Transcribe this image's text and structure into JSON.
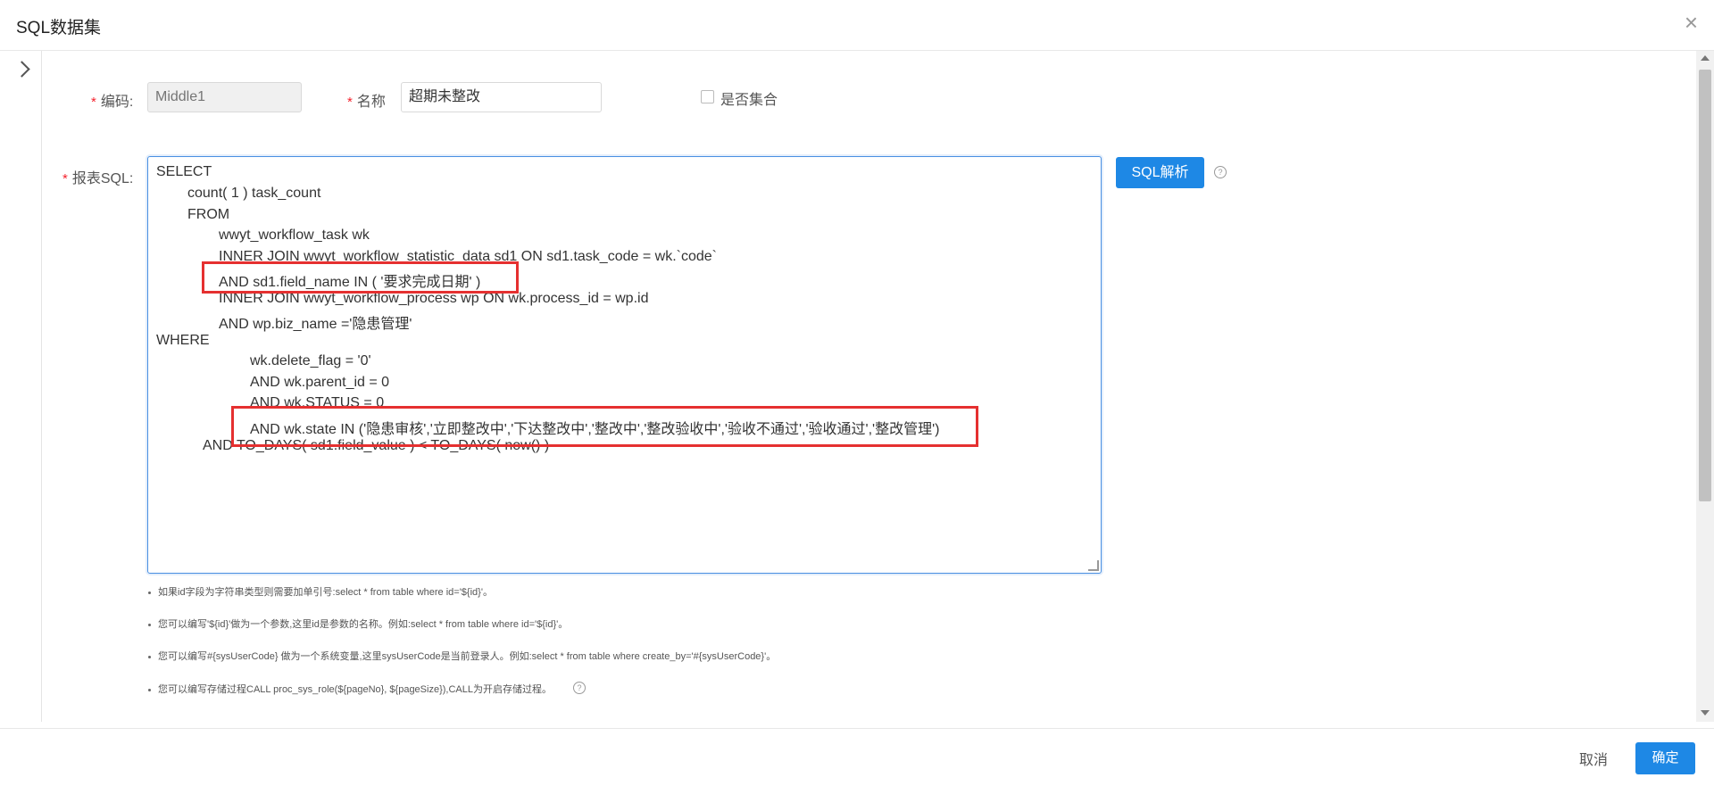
{
  "dialog": {
    "title": "SQL数据集"
  },
  "form": {
    "code": {
      "label": "编码:",
      "placeholder": "Middle1"
    },
    "name": {
      "label": "名称",
      "value": "超期未整改"
    },
    "is_collection": {
      "label": "是否集合",
      "checked": false
    },
    "sql": {
      "label": "报表SQL:",
      "lines": [
        "SELECT",
        "count( 1 ) task_count",
        "FROM",
        "wwyt_workflow_task wk",
        "INNER JOIN wwyt_workflow_statistic_data sd1 ON sd1.task_code = wk.`code`",
        "AND sd1.field_name IN ( '要求完成日期' )",
        "INNER JOIN wwyt_workflow_process wp ON wk.process_id = wp.id",
        "AND wp.biz_name ='隐患管理'",
        "WHERE",
        "wk.delete_flag = '0'",
        "AND wk.parent_id = 0",
        "AND wk.STATUS = 0",
        "AND wk.state IN ('隐患审核','立即整改中','下达整改中','整改中','整改验收中','验收不通过','验收通过','整改管理')",
        "AND TO_DAYS( sd1.field_value ) < TO_DAYS( now() )"
      ]
    },
    "sql_parse_button": "SQL解析"
  },
  "notes": [
    "如果id字段为字符串类型则需要加单引号:select * from table where id='${id}'。",
    "您可以编写'${id}'做为一个参数,这里id是参数的名称。例如:select * from table where id='${id}'。",
    "您可以编写#{sysUserCode} 做为一个系统变量,这里sysUserCode是当前登录人。例如:select * from table where create_by='#{sysUserCode}'。",
    "您可以编写存储过程CALL proc_sys_role(${pageNo}, ${pageSize}),CALL为开启存储过程。"
  ],
  "footer": {
    "cancel": "取消",
    "confirm": "确定"
  },
  "colors": {
    "primary": "#1e88e5",
    "required": "#f5222d",
    "highlight": "#e53030"
  }
}
